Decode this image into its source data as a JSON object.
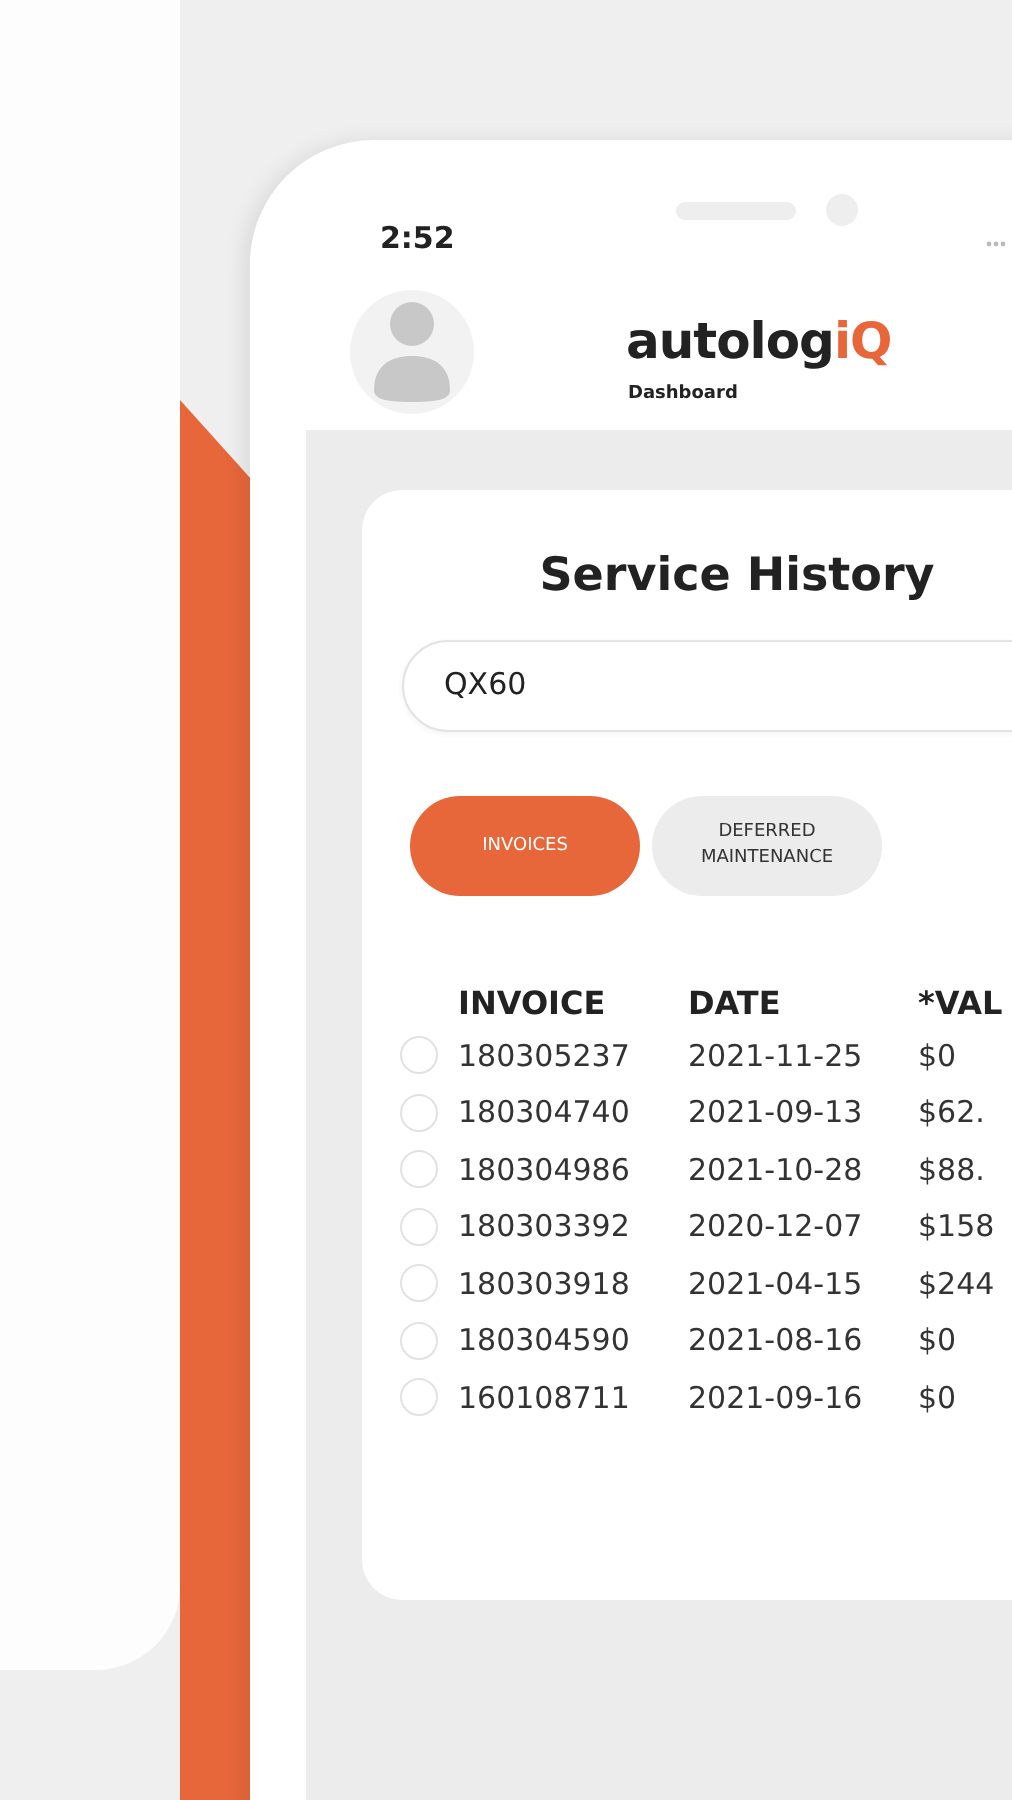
{
  "status_bar": {
    "time": "2:52"
  },
  "header": {
    "logo": {
      "main": "autolog",
      "accent": "iQ"
    },
    "subtitle": "Dashboard"
  },
  "title": "Service History",
  "search": {
    "value": "QX60"
  },
  "tabs": [
    {
      "label": "INVOICES",
      "selected": true
    },
    {
      "label": "DEFERRED MAINTENANCE",
      "selected": false
    }
  ],
  "table": {
    "columns": [
      "INVOICE",
      "DATE",
      "*VAL"
    ],
    "rows": [
      {
        "selected": false,
        "cells": [
          "180305237",
          "2021-11-25",
          "$0"
        ]
      },
      {
        "selected": false,
        "cells": [
          "180304740",
          "2021-09-13",
          "$62."
        ]
      },
      {
        "selected": false,
        "cells": [
          "180304986",
          "2021-10-28",
          "$88."
        ]
      },
      {
        "selected": false,
        "cells": [
          "180303392",
          "2020-12-07",
          "$158"
        ]
      },
      {
        "selected": false,
        "cells": [
          "180303918",
          "2021-04-15",
          "$244"
        ]
      },
      {
        "selected": false,
        "cells": [
          "180304590",
          "2021-08-16",
          "$0"
        ]
      },
      {
        "selected": false,
        "cells": [
          "160108711",
          "2021-09-16",
          "$0"
        ]
      }
    ]
  }
}
